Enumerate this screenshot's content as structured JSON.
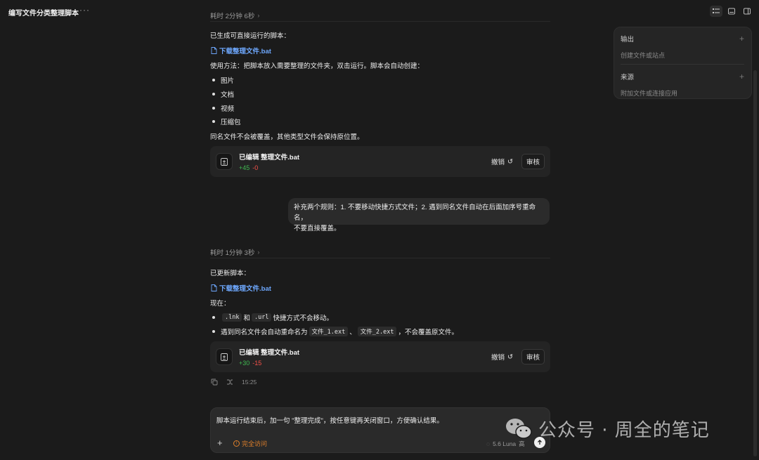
{
  "header": {
    "title": "编写文件分类整理脚本",
    "more": "···"
  },
  "turn1": {
    "elapsed": "耗时 2分钟 6秒",
    "intro": "已生成可直接运行的脚本：",
    "link": "下载整理文件.bat",
    "usage": "使用方法：把脚本放入需要整理的文件夹，双击运行。脚本会自动创建：",
    "bullets": [
      "图片",
      "文档",
      "视频",
      "压缩包"
    ],
    "note": "同名文件不会被覆盖，其他类型文件会保持原位置。",
    "card": {
      "title": "已编辑 整理文件.bat",
      "added": "+45",
      "removed": "-0",
      "undo": "撤销",
      "review": "审核"
    }
  },
  "user_message": {
    "line1": "补充两个规则：1. 不要移动快捷方式文件；2. 遇到同名文件自动在后面加序号重命名，",
    "line2": "不要直接覆盖。"
  },
  "turn2": {
    "elapsed": "耗时 1分钟 3秒",
    "intro": "已更新脚本：",
    "link": "下载整理文件.bat",
    "now": "现在：",
    "bullet1": {
      "code1": ".lnk",
      "and": "和",
      "code2": ".url",
      "rest": "快捷方式不会移动。"
    },
    "bullet2": {
      "pre": "遇到同名文件会自动重命名为",
      "code1": "文件_1.ext",
      "sep": "、",
      "code2": "文件_2.ext",
      "post": "，不会覆盖原文件。"
    },
    "card": {
      "title": "已编辑 整理文件.bat",
      "added": "+30",
      "removed": "-15",
      "undo": "撤销",
      "review": "审核"
    },
    "time": "15:25"
  },
  "composer": {
    "text": "脚本运行结束后，加一句 \"整理完成\"，按任意键再关闭窗口，方便确认结果。",
    "plus": "+",
    "access": "完全访问",
    "model": "5.6 Luna",
    "level": "高"
  },
  "side_panel": {
    "output_title": "输出",
    "output_sub": "创建文件或站点",
    "source_title": "来源",
    "source_sub": "附加文件或连接应用"
  },
  "watermark": {
    "text": "公众号 · 周全的笔记"
  },
  "colors": {
    "background": "#1b1b1b",
    "link": "#6ea8fe",
    "added": "#3fb950",
    "removed": "#f85149",
    "access": "#e0802a"
  }
}
